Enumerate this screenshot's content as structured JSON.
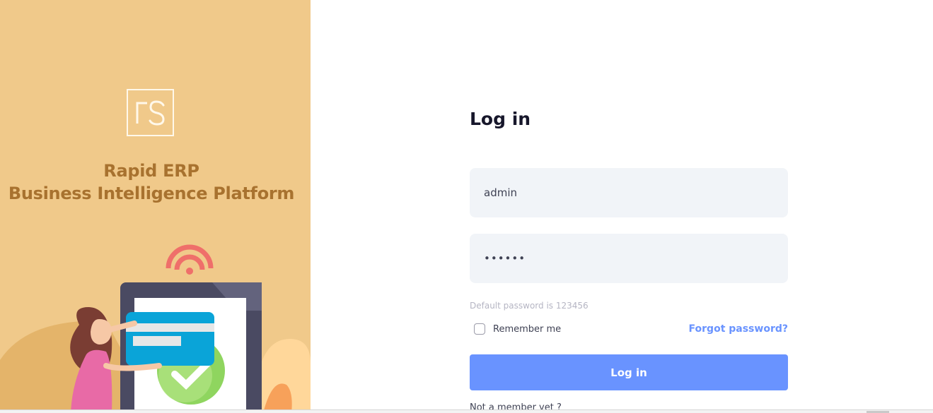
{
  "brand": {
    "logo_icon": "fs-logo",
    "line1": "Rapid ERP",
    "line2": "Business Intelligence Platform",
    "panel_color": "#f0c98a",
    "text_color": "#a8722f"
  },
  "login": {
    "title": "Log in",
    "username_value": "admin",
    "password_value": "••••••",
    "hint": "Default password is 123456",
    "remember_label": "Remember me",
    "forgot_label": "Forgot password?",
    "submit_label": "Log in",
    "signup_text": "Not a member yet ?",
    "accent_color": "#6993ff"
  }
}
